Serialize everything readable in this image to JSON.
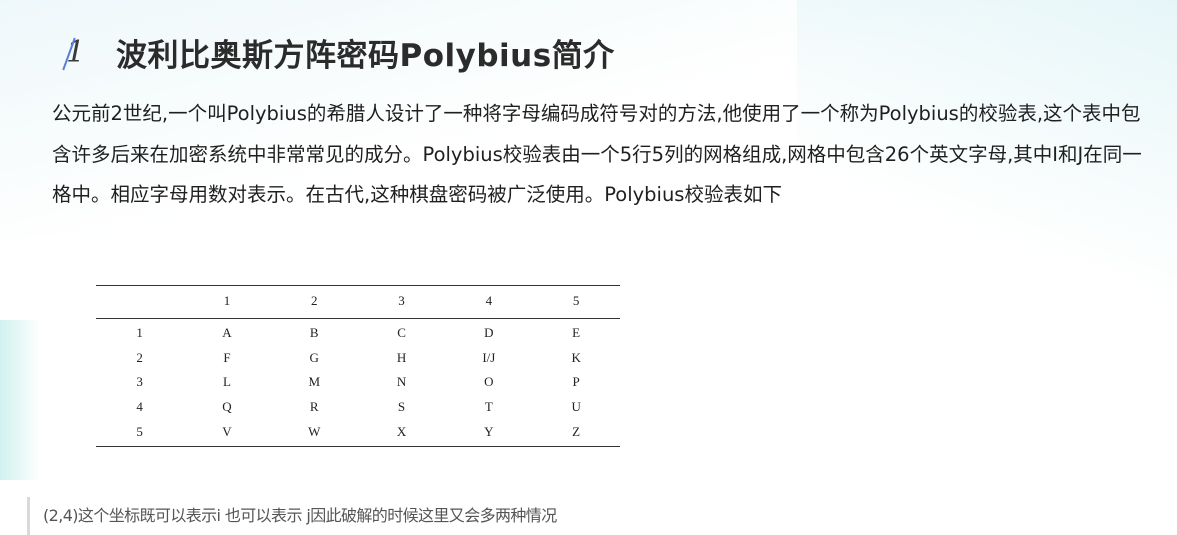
{
  "heading": {
    "number": "1",
    "title": "波利比奥斯方阵密码Polybius简介"
  },
  "intro": "公元前2世纪,一个叫Polybius的希腊人设计了一种将字母编码成符号对的方法,他使用了一个称为Polybius的校验表,这个表中包含许多后来在加密系统中非常常见的成分。Polybius校验表由一个5行5列的网格组成,网格中包含26个英文字母,其中I和J在同一格中。相应字母用数对表示。在古代,这种棋盘密码被广泛使用。Polybius校验表如下",
  "table": {
    "header": [
      "",
      "1",
      "2",
      "3",
      "4",
      "5"
    ],
    "rows": [
      [
        "1",
        "A",
        "B",
        "C",
        "D",
        "E"
      ],
      [
        "2",
        "F",
        "G",
        "H",
        "I/J",
        "K"
      ],
      [
        "3",
        "L",
        "M",
        "N",
        "O",
        "P"
      ],
      [
        "4",
        "Q",
        "R",
        "S",
        "T",
        "U"
      ],
      [
        "5",
        "V",
        "W",
        "X",
        "Y",
        "Z"
      ]
    ]
  },
  "note": "(2,4)这个坐标既可以表示i 也可以表示 j因此破解的时候这里又会多两种情况",
  "colors": {
    "slash": "#5b7fd6",
    "quote_border": "#d9d9d9"
  }
}
